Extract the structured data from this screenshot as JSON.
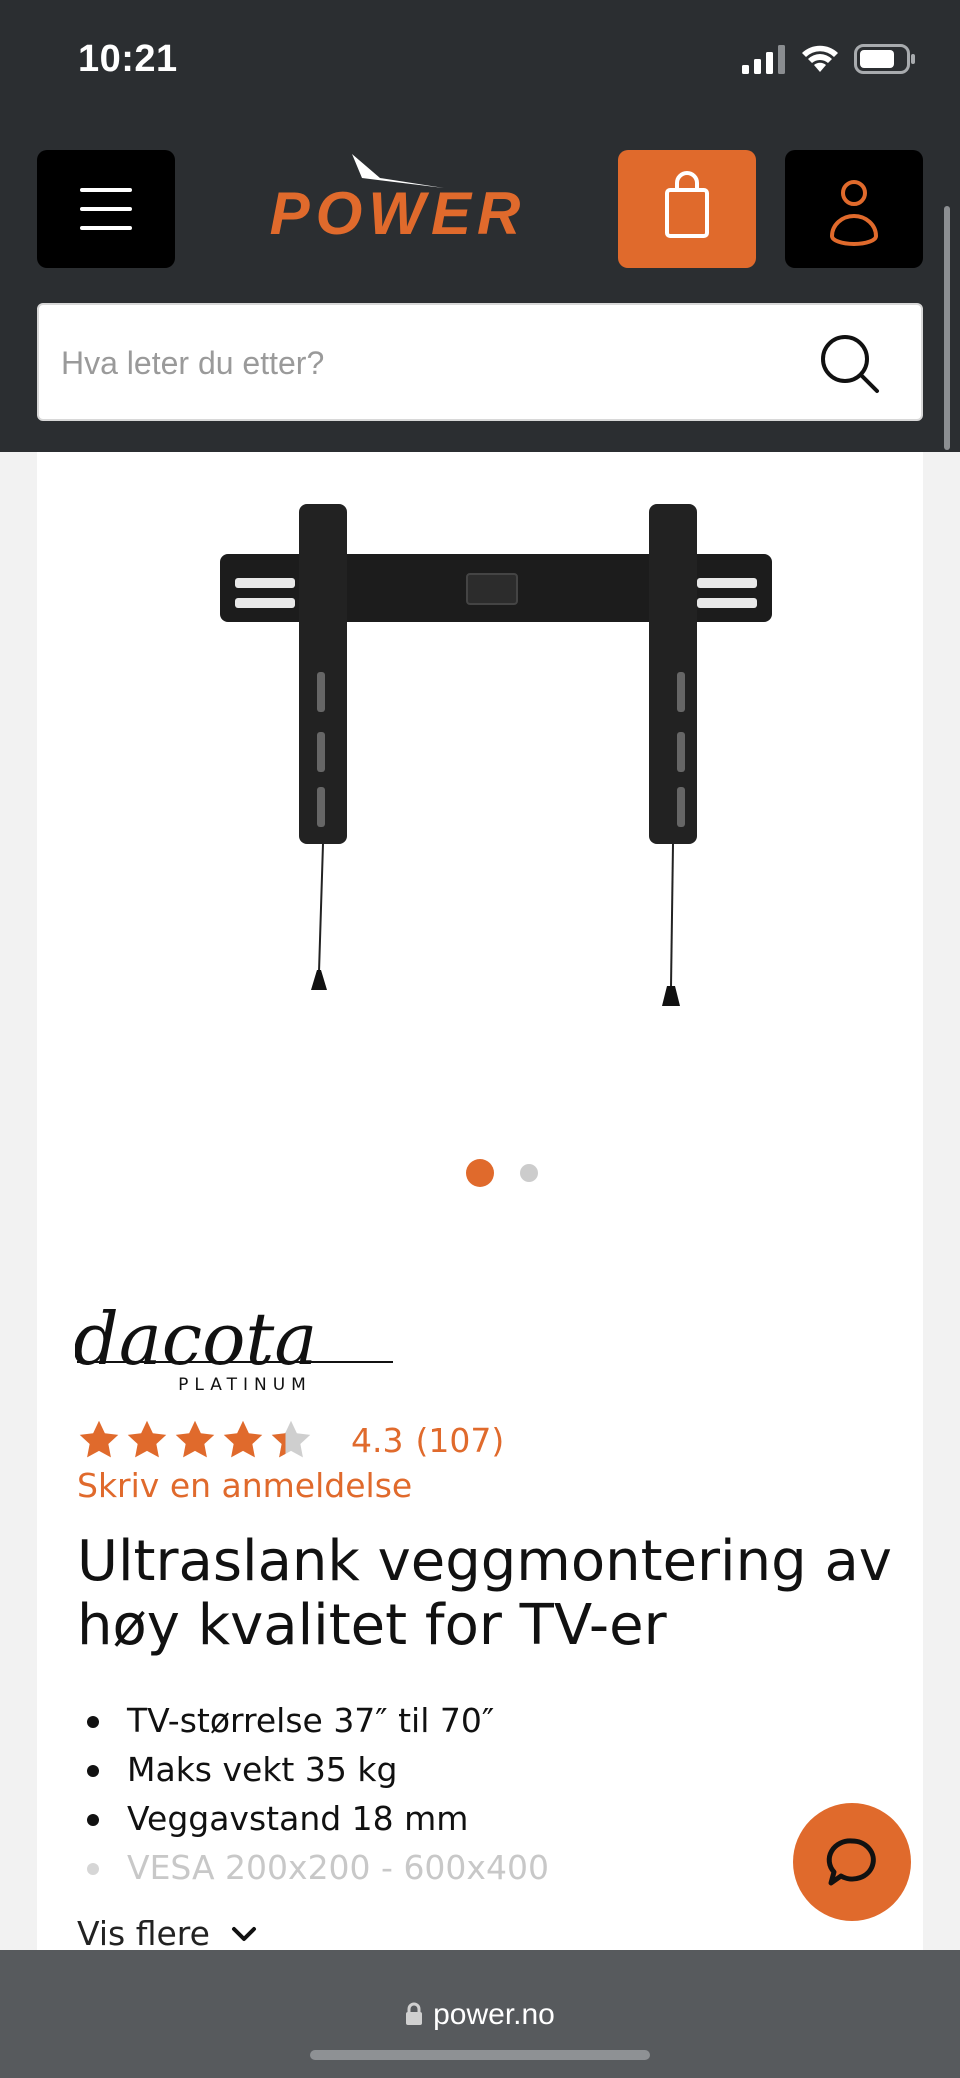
{
  "status_bar": {
    "time": "10:21"
  },
  "header": {
    "logo_text": "POWER",
    "search": {
      "placeholder": "Hva leter du etter?",
      "value": ""
    }
  },
  "gallery": {
    "current_index": 1,
    "total": 2,
    "active_color": "#e06a2c",
    "inactive_color": "#cccccc"
  },
  "product": {
    "brand": "dacota",
    "brand_sub": "PLATINUM",
    "rating": {
      "value": "4.3",
      "count": "(107)",
      "stars_fraction": 0.86
    },
    "review_link": "Skriv en anmeldelse",
    "title": "Ultraslank veggmontering av høy kvalitet for TV-er",
    "features": [
      "TV-størrelse 37″ til 70″",
      "Maks vekt 35 kg",
      "Veggavstand 18 mm",
      "VESA 200x200 - 600x400"
    ],
    "show_more": "Vis flere"
  },
  "url_bar": {
    "domain": "power.no"
  },
  "colors": {
    "brand": "#e06a2c",
    "header_bg": "#2b2e31",
    "url_bar_bg": "#575a5d"
  }
}
